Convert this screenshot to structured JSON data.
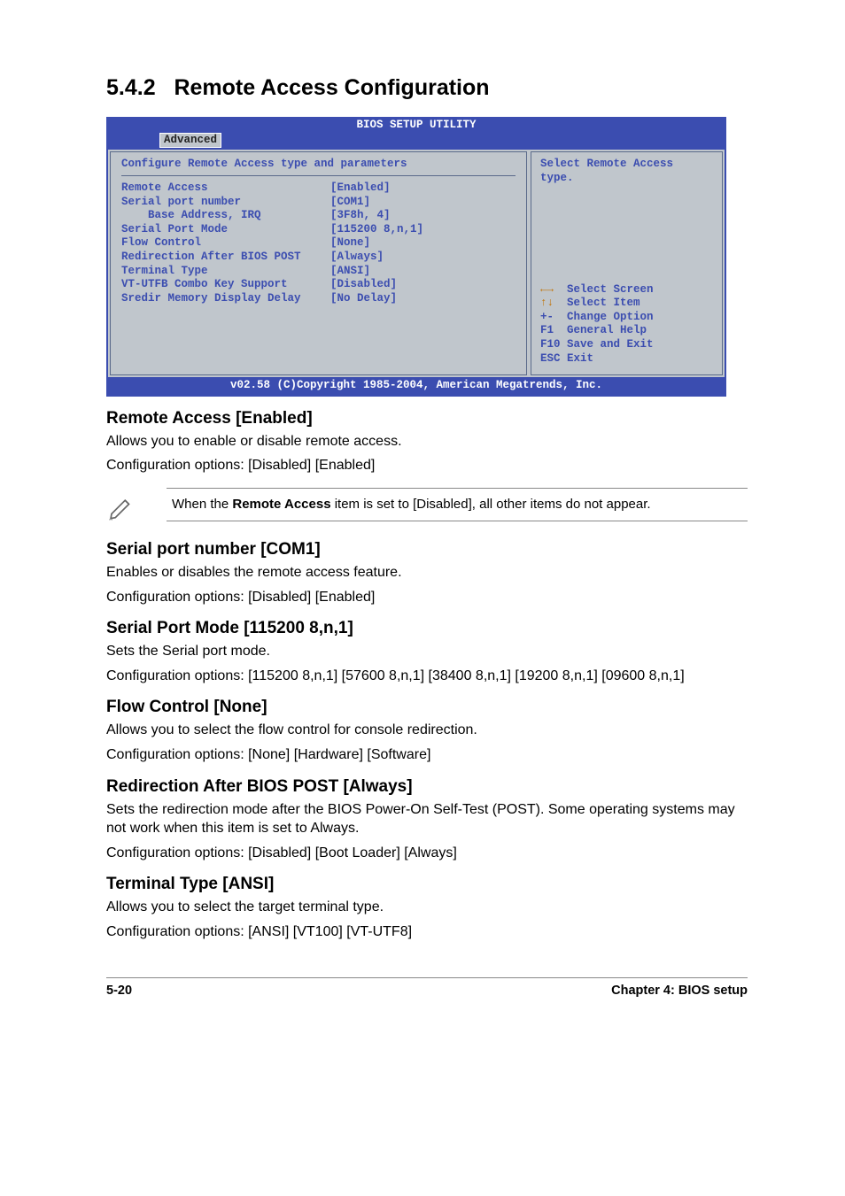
{
  "section_number": "5.4.2",
  "section_title": "Remote Access Configuration",
  "bios": {
    "header_title": "BIOS SETUP UTILITY",
    "tab_label": "Advanced",
    "left_title": "Configure Remote Access type and parameters",
    "rows": [
      {
        "label": "Remote Access",
        "value": "[Enabled]"
      },
      {
        "label": "",
        "value": ""
      },
      {
        "label": "Serial port number",
        "value": "[COM1]"
      },
      {
        "label": "    Base Address, IRQ",
        "value": "[3F8h, 4]"
      },
      {
        "label": "Serial Port Mode",
        "value": "[115200 8,n,1]"
      },
      {
        "label": "Flow Control",
        "value": "[None]"
      },
      {
        "label": "Redirection After BIOS POST",
        "value": "[Always]"
      },
      {
        "label": "Terminal Type",
        "value": "[ANSI]"
      },
      {
        "label": "VT-UTFB Combo Key Support",
        "value": "[Disabled]"
      },
      {
        "label": "Sredir Memory Display Delay",
        "value": "[No Delay]"
      }
    ],
    "help_text": "Select Remote Access type.",
    "legend_lines": [
      {
        "key": "←→",
        "txt": "Select Screen",
        "sel": true
      },
      {
        "key": "↑↓",
        "txt": "Select Item",
        "sel": true
      },
      {
        "key": "+-",
        "txt": "Change Option",
        "sel": false
      },
      {
        "key": "F1",
        "txt": "General Help",
        "sel": false
      },
      {
        "key": "F10",
        "txt": "Save and Exit",
        "sel": false
      },
      {
        "key": "ESC",
        "txt": "Exit",
        "sel": false
      }
    ],
    "footer": "v02.58 (C)Copyright 1985-2004, American Megatrends, Inc."
  },
  "sections": {
    "remote_access": {
      "heading": "Remote Access [Enabled]",
      "p1": "Allows you to enable or disable remote access.",
      "p2": "Configuration options: [Disabled] [Enabled]"
    },
    "note": {
      "prefix": "When the ",
      "bold": "Remote Access",
      "suffix": " item is set to [Disabled], all other items do not appear."
    },
    "serial_port_number": {
      "heading": "Serial port number [COM1]",
      "p1": "Enables or disables the remote access feature.",
      "p2": "Configuration options: [Disabled] [Enabled]"
    },
    "serial_port_mode": {
      "heading": "Serial Port Mode [115200 8,n,1]",
      "p1": "Sets the Serial port mode.",
      "p2": "Configuration options: [115200 8,n,1] [57600 8,n,1] [38400 8,n,1] [19200 8,n,1] [09600 8,n,1]"
    },
    "flow_control": {
      "heading": "Flow Control [None]",
      "p1": "Allows you to select the flow control for console redirection.",
      "p2": "Configuration options: [None] [Hardware] [Software]"
    },
    "redirection": {
      "heading": "Redirection After BIOS POST [Always]",
      "p1": "Sets the redirection mode after the BIOS Power-On Self-Test (POST). Some operating systems may not work when this item is set to Always.",
      "p2": "Configuration options: [Disabled] [Boot Loader] [Always]"
    },
    "terminal_type": {
      "heading": "Terminal Type [ANSI]",
      "p1": "Allows you to select the target terminal type.",
      "p2": "Configuration options: [ANSI] [VT100] [VT-UTF8]"
    }
  },
  "footer": {
    "page": "5-20",
    "chapter": "Chapter 4: BIOS setup"
  }
}
